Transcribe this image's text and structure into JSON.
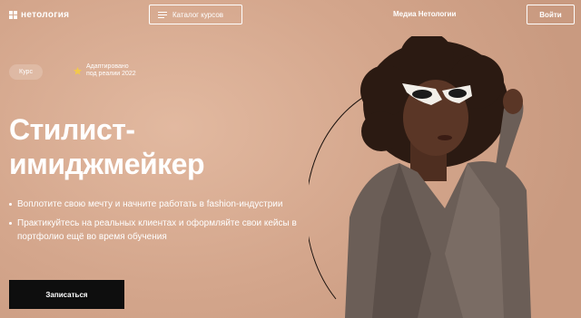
{
  "header": {
    "logo_text": "нетология",
    "catalog_label": "Каталог курсов",
    "media_label": "Медиа Нетологии",
    "login_label": "Войти"
  },
  "badges": {
    "course": "Курс",
    "adapted_line1": "Адаптировано",
    "adapted_line2": "под реалии 2022"
  },
  "title": {
    "line1": "Стилист-",
    "line2": "имиджмейкер"
  },
  "bullets": [
    "Воплотите свою мечту и начните работать в fashion-индустрии",
    "Практикуйтесь на реальных клиентах и оформляйте свои кейсы в портфолио ещё во время обучения"
  ],
  "cta_label": "Записаться",
  "colors": {
    "background": "#d9ad94",
    "text": "#ffffff",
    "cta_bg": "#0e0e0e",
    "star": "#f2c94c",
    "coat": "#6b5e57",
    "hair": "#2b1a12",
    "skin": "#5a3626"
  },
  "icons": {
    "menu": "hamburger-icon",
    "badge": "star-icon",
    "logo": "grid-logo-icon"
  }
}
